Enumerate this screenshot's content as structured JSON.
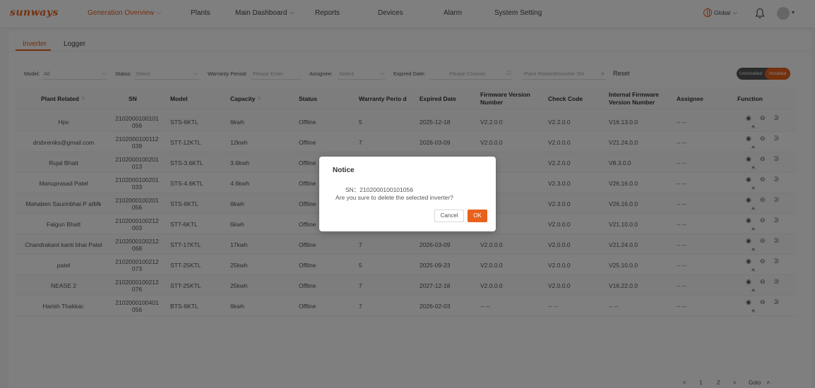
{
  "brand": {
    "logo_text": "sunways",
    "accent": "#e8621d"
  },
  "nav": {
    "items": [
      {
        "label": "Generation Overview",
        "active": true,
        "dropdown": true
      },
      {
        "label": "Plants",
        "active": false,
        "dropdown": false
      },
      {
        "label": "Main Dashboard",
        "active": false,
        "dropdown": true
      },
      {
        "label": "Reports",
        "active": false,
        "dropdown": false
      },
      {
        "label": "Devices",
        "active": false,
        "dropdown": false
      },
      {
        "label": "Alarm",
        "active": false,
        "dropdown": false
      },
      {
        "label": "System Setting",
        "active": false,
        "dropdown": false
      }
    ],
    "language": "Global",
    "icons": [
      "globe-icon",
      "bell-icon",
      "avatar"
    ]
  },
  "tabs": [
    {
      "label": "Inverter",
      "active": true
    },
    {
      "label": "Logger",
      "active": false
    }
  ],
  "filters": {
    "model_label": "Model:",
    "model_value": "All",
    "status_label": "Status:",
    "status_placeholder": "Select",
    "warranty_label": "Warranty Period:",
    "warranty_placeholder": "Please Enter",
    "assignee_label": "Assignee:",
    "assignee_placeholder": "Select",
    "expired_label": "Expired Date:",
    "expired_placeholder": "Please Choose",
    "search_placeholder": "Plant Related/Inverter SN",
    "reset_label": "Reset",
    "toggle_left": "Uninstalled",
    "toggle_right": "Installed"
  },
  "table": {
    "headers": {
      "plant": "Plant Related",
      "sn": "SN",
      "model": "Model",
      "capacity": "Capacity",
      "status": "Status",
      "warranty": "Warranty Perio d",
      "expired": "Expired Date",
      "firmware": "Firmware Version Number",
      "check": "Check Code",
      "internal": "Internal Firmware Version Number",
      "assignee": "Assignee",
      "function": "Function"
    },
    "rows": [
      {
        "plant": "Hpv",
        "sn": "2102000100101 056",
        "model": "STS-6KTL",
        "capacity": "6kwh",
        "status": "Offline",
        "warranty": "5",
        "expired": "2025-12-18",
        "firmware": "V2.2.0.0",
        "check": "V2.2.0.0",
        "internal": "V16.13.0.0",
        "assignee": "-- --"
      },
      {
        "plant": "drsbreniks@gmail.com",
        "sn": "2102000100112 039",
        "model": "STT-12KTL",
        "capacity": "12kwh",
        "status": "Offline",
        "warranty": "7",
        "expired": "2026-03-09",
        "firmware": "V2.0.0.0",
        "check": "V2.0.0.0",
        "internal": "V21.24.0.0",
        "assignee": "-- --"
      },
      {
        "plant": "Rujal Bhatt",
        "sn": "2102000100201 013",
        "model": "STS-3.6KTL",
        "capacity": "3.6kwh",
        "status": "Offline",
        "warranty": "",
        "expired": "",
        "firmware": "",
        "check": "V2.2.0.0",
        "internal": "V8.3.0.0",
        "assignee": "-- --"
      },
      {
        "plant": "Manuprasad Patel",
        "sn": "2102000100201 033",
        "model": "STS-4.6KTL",
        "capacity": "4.6kwh",
        "status": "Offline",
        "warranty": "",
        "expired": "",
        "firmware": "",
        "check": "V2.3.0.0",
        "internal": "V26.16.0.0",
        "assignee": "-- --"
      },
      {
        "plant": "Mahaben Saurinbhai P atMk",
        "sn": "2102000100201 056",
        "model": "STS-6KTL",
        "capacity": "6kwh",
        "status": "Offline",
        "warranty": "",
        "expired": "",
        "firmware": "",
        "check": "V2.3.0.0",
        "internal": "V26.16.0.0",
        "assignee": "-- --"
      },
      {
        "plant": "Falgun Bhatt",
        "sn": "2102000100212 003",
        "model": "STT-6KTL",
        "capacity": "6kwh",
        "status": "Offline",
        "warranty": "",
        "expired": "",
        "firmware": "",
        "check": "V2.0.0.0",
        "internal": "V21.10.0.0",
        "assignee": "-- --"
      },
      {
        "plant": "Chandrakant kanti bhai Patel",
        "sn": "2102000100212 068",
        "model": "STT-17KTL",
        "capacity": "17kwh",
        "status": "Offline",
        "warranty": "7",
        "expired": "2026-03-09",
        "firmware": "V2.0.0.0",
        "check": "V2.0.0.0",
        "internal": "V21.24.0.0",
        "assignee": "-- --"
      },
      {
        "plant": "patel",
        "sn": "2102000100212 073",
        "model": "STT-25KTL",
        "capacity": "25kwh",
        "status": "Offline",
        "warranty": "5",
        "expired": "2025-09-23",
        "firmware": "V2.0.0.0",
        "check": "V2.0.0.0",
        "internal": "V25.10.0.0",
        "assignee": "-- --"
      },
      {
        "plant": "NEASE 2",
        "sn": "2102000100212 076",
        "model": "STT-25KTL",
        "capacity": "25kwh",
        "status": "Offline",
        "warranty": "7",
        "expired": "2027-12-18",
        "firmware": "V2.0.0.0",
        "check": "V2.0.0.0",
        "internal": "V16.22.0.0",
        "assignee": "-- --"
      },
      {
        "plant": "Harish Thakkar.",
        "sn": "2102000100401 056",
        "model": "BTS-6KTL",
        "capacity": "6kwh",
        "status": "Offline",
        "warranty": "7",
        "expired": "2026-02-03",
        "firmware": "-- --",
        "check": "-- --",
        "internal": "-- --",
        "assignee": "-- --"
      }
    ]
  },
  "pagination": {
    "prev": "<",
    "pages": [
      "1",
      "2"
    ],
    "next": ">",
    "goto_label": "Goto"
  },
  "modal": {
    "title": "Notice",
    "sn_line": "SN：2102000100101056",
    "message": "Are you sure to delete the selected inverter?",
    "cancel_label": "Cancel",
    "ok_label": "OK"
  }
}
